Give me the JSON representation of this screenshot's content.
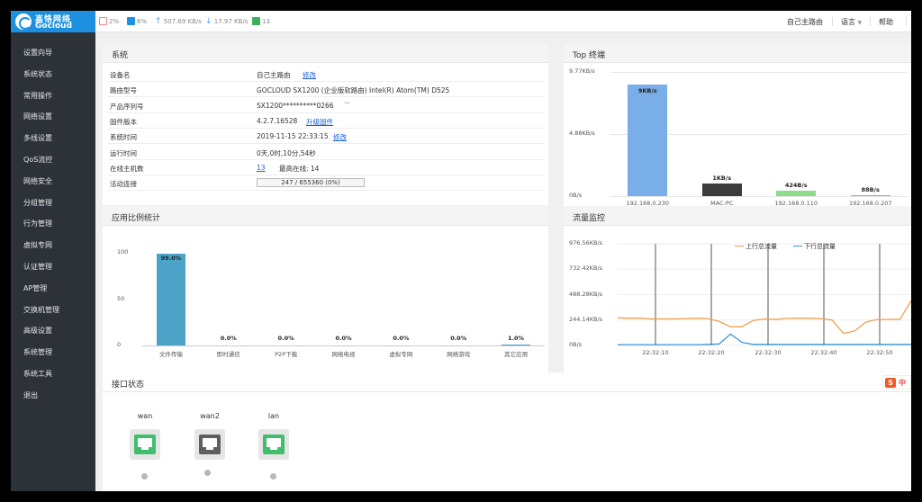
{
  "logo": {
    "cn": "高恪网络",
    "en": "Gocloud"
  },
  "status_bar": {
    "cpu": {
      "icon": "cpu-icon",
      "value": "2%"
    },
    "ram": {
      "icon": "ram-icon",
      "value": "6%"
    },
    "upload": {
      "icon": "upload-arrow-icon",
      "value": "507.69 KB/s"
    },
    "download": {
      "icon": "download-arrow-icon",
      "value": "17.97 KB/s"
    },
    "hosts": {
      "icon": "monitor-icon",
      "value": "13"
    }
  },
  "header_nav": {
    "router": "自己主路由",
    "language": "语言",
    "help": "帮助"
  },
  "colors": {
    "brand": "#1d90e0",
    "sidebar": "#2d3239",
    "bar_blue": "#7aaee8",
    "bar_dark": "#3c3c3c",
    "bar_green": "#8bdc8b",
    "app_bar": "#4ba3c8",
    "upload_line": "#f0a04b",
    "download_line": "#3c96d8",
    "port_green": "#3fbf6c",
    "port_gray": "#5f5f5f"
  },
  "sidebar": {
    "items": [
      "设置向导",
      "系统状态",
      "常用操作",
      "网络设置",
      "多线设置",
      "QoS流控",
      "网络安全",
      "分组管理",
      "行为管理",
      "虚拟专网",
      "认证管理",
      "AP管理",
      "交换机管理",
      "高级设置",
      "系统管理",
      "系统工具",
      "退出"
    ]
  },
  "system": {
    "title": "系统",
    "rows": [
      {
        "label": "设备名",
        "value": "自己主路由",
        "link": "修改"
      },
      {
        "label": "路由型号",
        "value": "GOCLOUD SX1200 (企业版软路由) Intel(R) Atom(TM) D525",
        "link": ""
      },
      {
        "label": "产品序列号",
        "value": "SX1200**********0266",
        "link": ""
      },
      {
        "label": "固件版本",
        "value": "4.2.7.16528",
        "link": "升级固件"
      },
      {
        "label": "系统时间",
        "value": "2019-11-15 22:33:15",
        "link": "修改"
      },
      {
        "label": "运行时间",
        "value": "0天,0时,10分,54秒",
        "link": ""
      },
      {
        "label": "在线主机数",
        "value": "13",
        "extra": "最高在线: 14",
        "link": ""
      },
      {
        "label": "活动连接",
        "value": "",
        "link": ""
      }
    ],
    "connections": {
      "text": "247 / 655360 (0%)",
      "percent": 0.04
    }
  },
  "top_terminal": {
    "title": "Top 终端",
    "chart_data": {
      "type": "bar",
      "title": "",
      "categories": [
        "192.168.0.230",
        "MAC-PC",
        "192.168.0.110",
        "192.168.0.207"
      ],
      "values": [
        9000,
        1000,
        424,
        88
      ],
      "data_labels": [
        "9KB/s",
        "1KB/s",
        "424B/s",
        "88B/s"
      ],
      "yticks": [
        "9.77KB/s",
        "4.88KB/s",
        "0B/s"
      ],
      "ylim": [
        0,
        10004
      ]
    }
  },
  "app_stats": {
    "title": "应用比例统计",
    "chart_data": {
      "type": "bar",
      "title": "",
      "categories": [
        "文件传输",
        "即时通信",
        "P2P下载",
        "网络电视",
        "虚拟专网",
        "网络游戏",
        "其它应用"
      ],
      "values": [
        99.0,
        0.0,
        0.0,
        0.0,
        0.0,
        0.0,
        1.0
      ],
      "data_labels": [
        "99.0%",
        "0.0%",
        "0.0%",
        "0.0%",
        "0.0%",
        "0.0%",
        "1.0%"
      ],
      "yticks": [
        "100",
        "50",
        "0"
      ],
      "ylim": [
        0,
        100
      ]
    }
  },
  "traffic": {
    "title": "流量监控",
    "chart_data": {
      "type": "line",
      "title": "",
      "yticks": [
        "976.56KB/s",
        "732.42KB/s",
        "488.28KB/s",
        "244.14KB/s",
        "0B/s"
      ],
      "xticks": [
        "22:32:10",
        "22:32:20",
        "22:32:30",
        "22:32:40",
        "22:32:50"
      ],
      "ylim": [
        0,
        976.56
      ],
      "legend": "top-right",
      "series": [
        {
          "name": "上行总流量",
          "values": [
            265,
            262,
            262,
            255,
            255,
            255,
            258,
            262,
            258,
            230,
            180,
            180,
            240,
            255,
            250,
            260,
            262,
            262,
            258,
            245,
            115,
            140,
            225,
            250,
            250,
            252,
            430
          ]
        },
        {
          "name": "下行总流量",
          "values": [
            8,
            8,
            8,
            8,
            8,
            8,
            8,
            8,
            10,
            15,
            110,
            30,
            10,
            10,
            10,
            10,
            10,
            10,
            10,
            10,
            10,
            10,
            10,
            10,
            10,
            10,
            10
          ]
        }
      ]
    }
  },
  "interfaces": {
    "title": "接口状态",
    "items": [
      {
        "name": "wan",
        "state": "up"
      },
      {
        "name": "wan2",
        "state": "down"
      },
      {
        "name": "lan",
        "state": "up"
      }
    ]
  },
  "ime_badge": {
    "letter": "S",
    "text": "中"
  }
}
